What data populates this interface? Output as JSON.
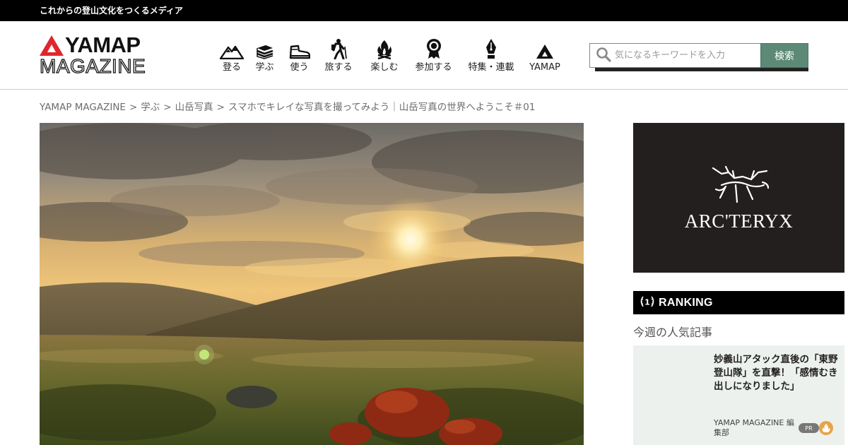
{
  "topbar": {
    "tagline": "これからの登山文化をつくるメディア"
  },
  "logo": {
    "line1": "YAMAP",
    "line2": "MAGAZINE",
    "accent_color": "#e0262d"
  },
  "nav": [
    {
      "label": "登る",
      "icon": "mountain-icon"
    },
    {
      "label": "学ぶ",
      "icon": "book-icon"
    },
    {
      "label": "使う",
      "icon": "boot-icon"
    },
    {
      "label": "旅する",
      "icon": "hiker-icon"
    },
    {
      "label": "楽しむ",
      "icon": "campfire-icon"
    },
    {
      "label": "参加する",
      "icon": "badge-icon"
    },
    {
      "label": "特集・連載",
      "icon": "pen-icon"
    },
    {
      "label": "YAMAP",
      "icon": "yamap-logo-icon"
    }
  ],
  "search": {
    "placeholder": "気になるキーワードを入力",
    "button_label": "検索",
    "button_color": "#5c8a76"
  },
  "breadcrumb": {
    "items": [
      "YAMAP MAGAZINE",
      "学ぶ",
      "山岳写真",
      "スマホでキレイな写真を撮ってみよう｜山岳写真の世界へようこそ＃01"
    ],
    "separator": ">"
  },
  "hero": {
    "icon": "sunset-mountain-photo"
  },
  "ad": {
    "brand": "ARC'TERYX",
    "icon": "archaeopteryx-logo-icon"
  },
  "ranking": {
    "heading": "RANKING",
    "subheading": "今週の人気記事",
    "card": {
      "title": "妙義山アタック直後の「東野登山隊」を直撃！「感情むき出しになりました」",
      "author": "YAMAP MAGAZINE 編集部",
      "badge": "PR"
    }
  }
}
